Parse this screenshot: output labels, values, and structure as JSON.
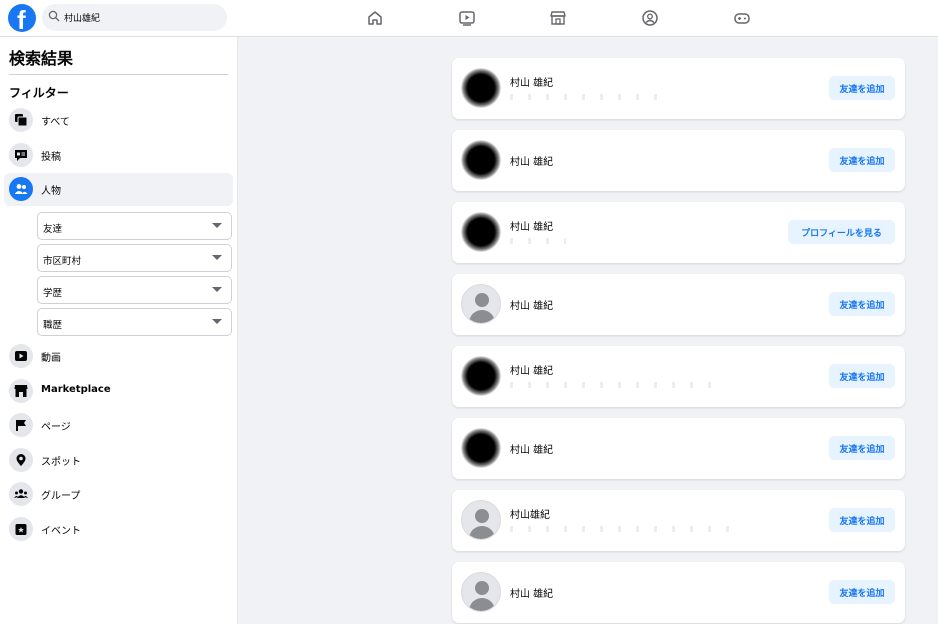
{
  "search": {
    "value": "村山雄紀",
    "placeholder": ""
  },
  "nav": {
    "items": [
      {
        "icon": "home-icon"
      },
      {
        "icon": "watch-icon"
      },
      {
        "icon": "marketplace-icon"
      },
      {
        "icon": "groups-icon"
      },
      {
        "icon": "gaming-icon"
      }
    ]
  },
  "sidebar": {
    "title": "検索結果",
    "filter_heading": "フィルター",
    "items": [
      {
        "label": "すべて",
        "icon": "all-icon"
      },
      {
        "label": "投稿",
        "icon": "posts-icon"
      },
      {
        "label": "人物",
        "icon": "people-icon",
        "active": true
      },
      {
        "label": "動画",
        "icon": "video-icon"
      },
      {
        "label": "Marketplace",
        "icon": "marketplace-icon"
      },
      {
        "label": "ページ",
        "icon": "pages-icon"
      },
      {
        "label": "スポット",
        "icon": "places-icon"
      },
      {
        "label": "グループ",
        "icon": "groups-icon"
      },
      {
        "label": "イベント",
        "icon": "events-icon"
      }
    ],
    "dropdowns": [
      {
        "label": "友達"
      },
      {
        "label": "市区町村"
      },
      {
        "label": "学歴"
      },
      {
        "label": "職歴"
      }
    ]
  },
  "results": [
    {
      "name": "村山 雄紀",
      "action": "友達を追加",
      "avatar": "blurred"
    },
    {
      "name": "村山 雄紀",
      "action": "友達を追加",
      "avatar": "blurred"
    },
    {
      "name": "村山 雄紀",
      "action": "プロフィールを見る",
      "avatar": "blurred"
    },
    {
      "name": "村山 雄紀",
      "action": "友達を追加",
      "avatar": "default"
    },
    {
      "name": "村山 雄紀",
      "action": "友達を追加",
      "avatar": "blurred"
    },
    {
      "name": "村山 雄紀",
      "action": "友達を追加",
      "avatar": "blurred"
    },
    {
      "name": "村山雄紀",
      "action": "友達を追加",
      "avatar": "default"
    },
    {
      "name": "村山 雄紀",
      "action": "友達を追加",
      "avatar": "default"
    }
  ],
  "colors": {
    "brand": "#1877f2",
    "button_bg": "#e7f3ff",
    "page_bg": "#f0f2f5"
  }
}
